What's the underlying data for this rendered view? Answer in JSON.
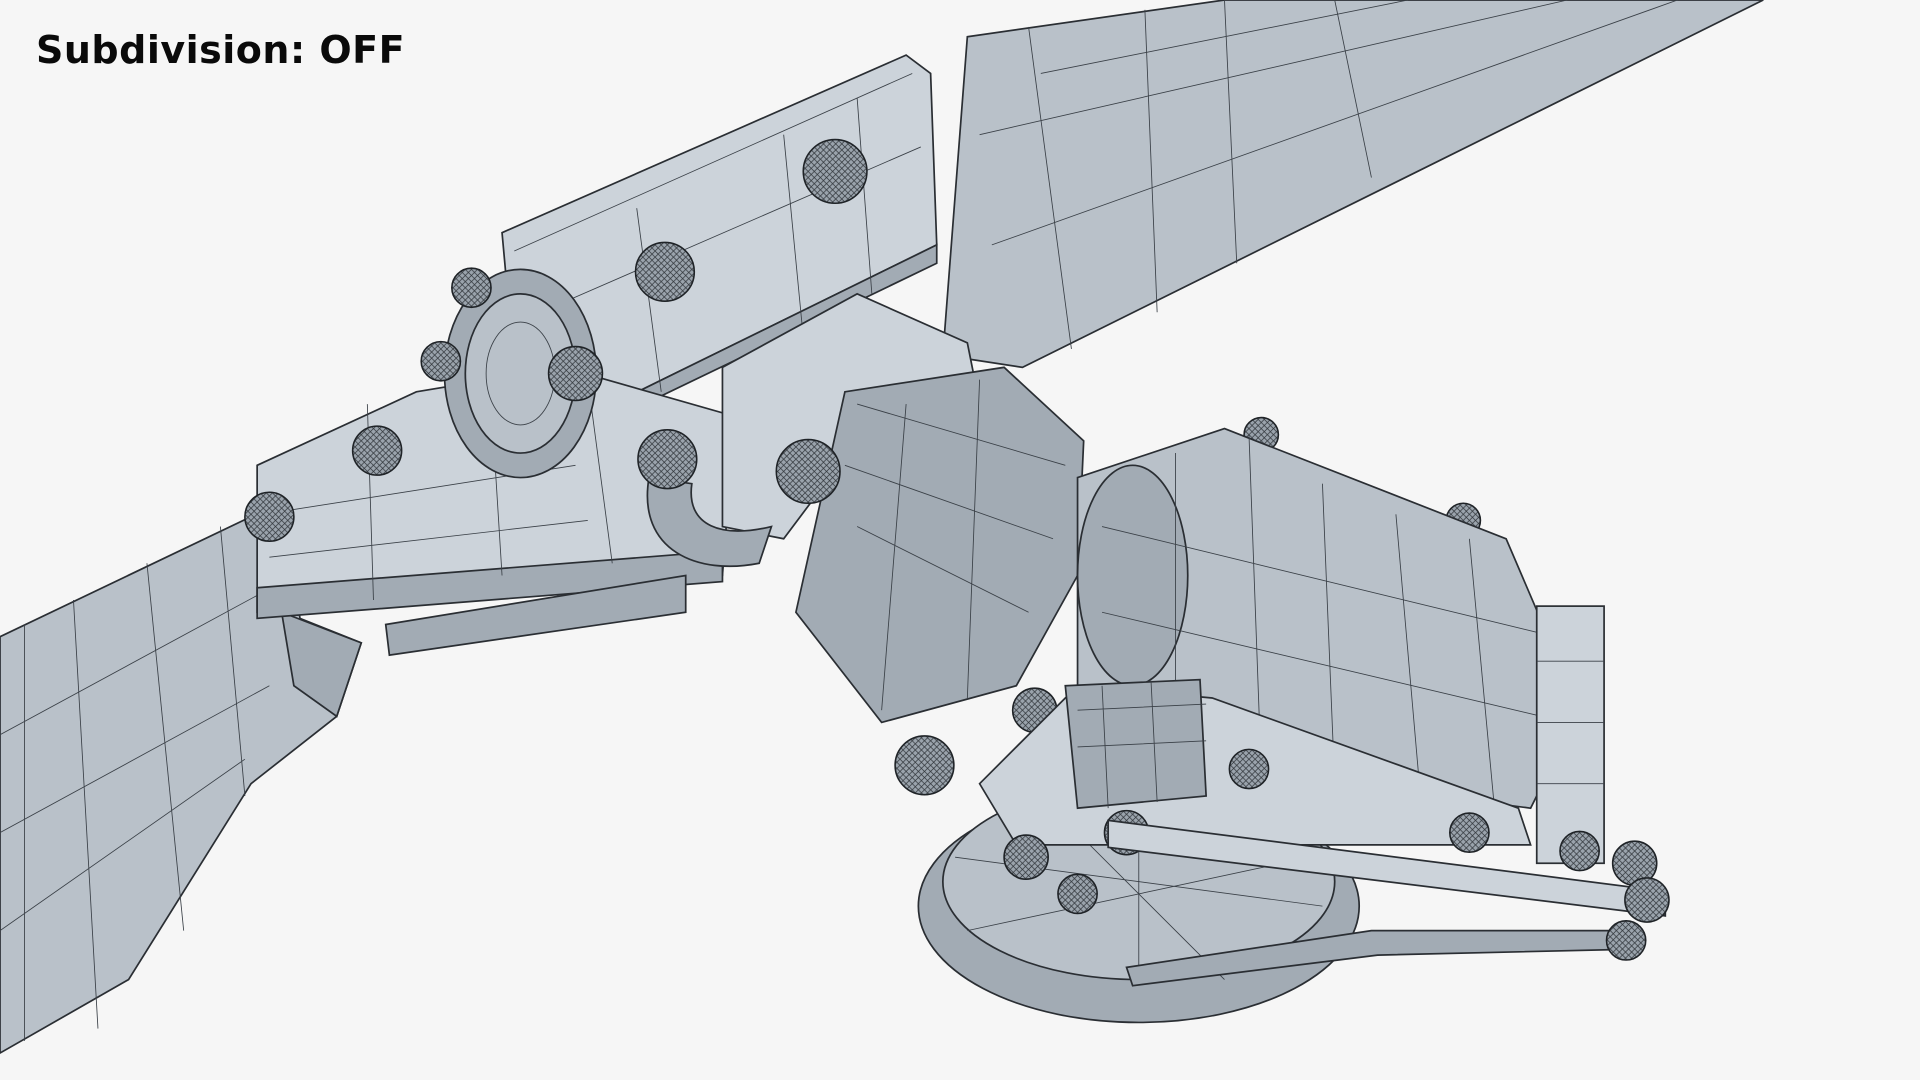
{
  "overlay": {
    "subdivision_label": "Subdivision: OFF"
  },
  "colors": {
    "background": "#f6f6f6",
    "mesh_fill": "#b9c1c9",
    "wire": "#2a2e33",
    "label": "#0a0a0a"
  }
}
